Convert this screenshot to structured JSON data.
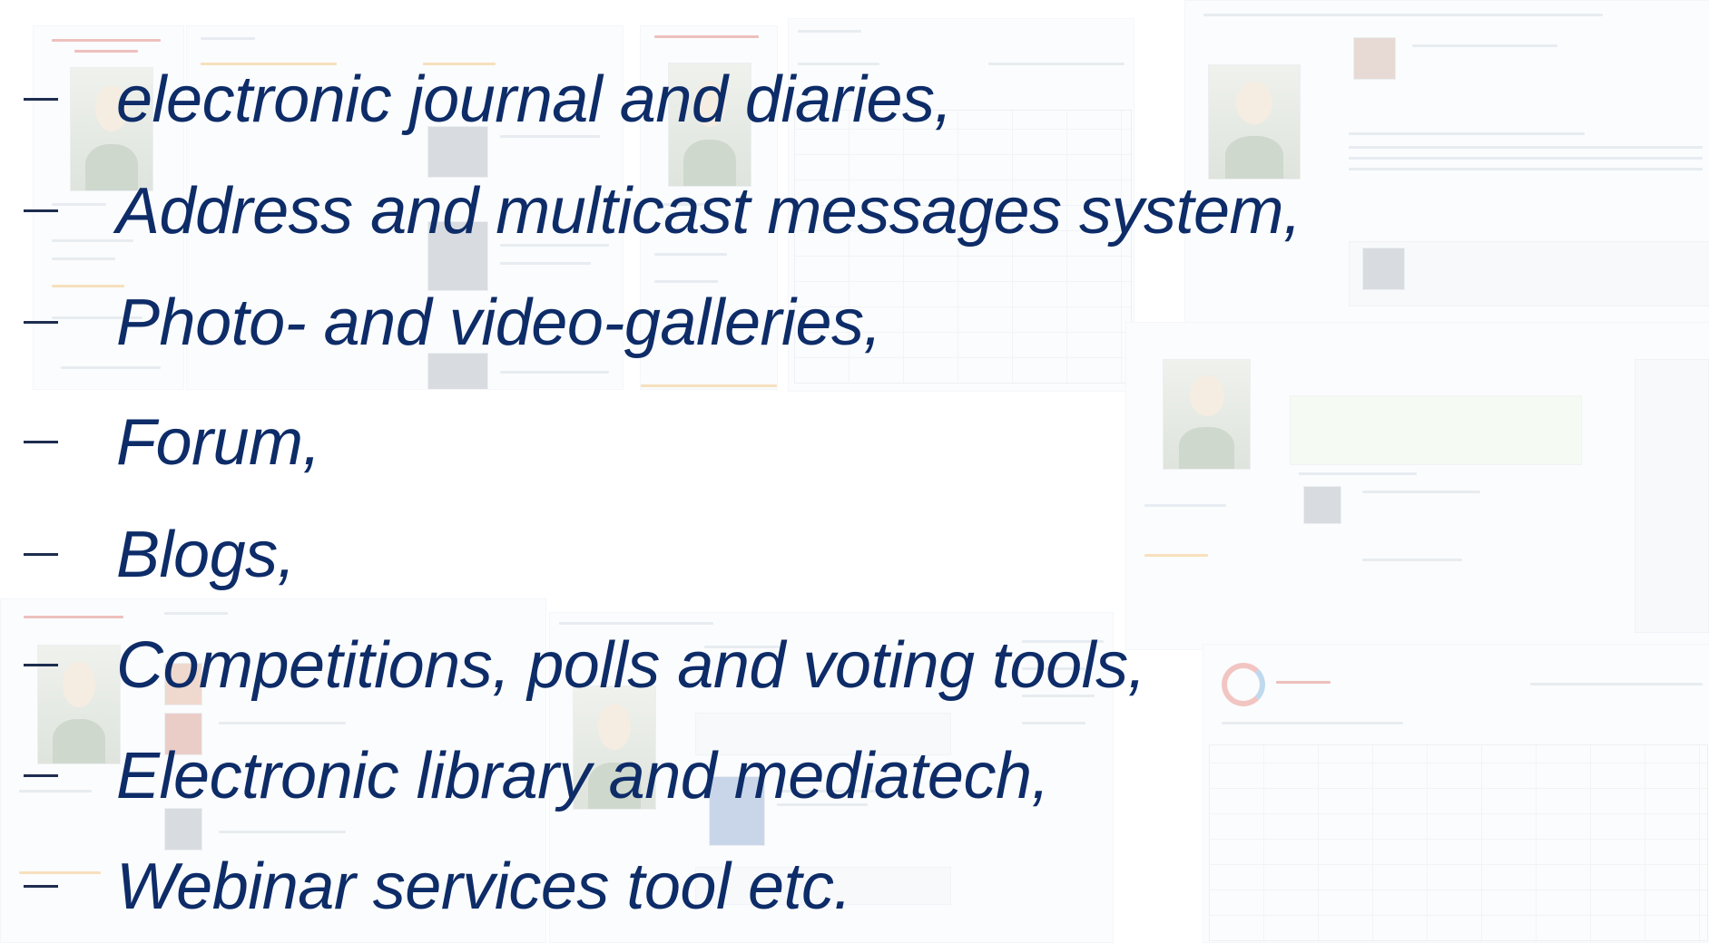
{
  "slide": {
    "bullet_marker": "–",
    "text_color": "#0d2c68",
    "items": [
      {
        "text": "electronic journal and diaries,"
      },
      {
        "text": "Address and multicast messages system,"
      },
      {
        "text": "Photo- and video-galleries,"
      },
      {
        "text": "Forum,"
      },
      {
        "text": "Blogs,"
      },
      {
        "text": "Competitions, polls and voting tools,"
      },
      {
        "text": "Electronic library and mediatech,"
      },
      {
        "text": "Webinar services tool etc."
      }
    ]
  }
}
